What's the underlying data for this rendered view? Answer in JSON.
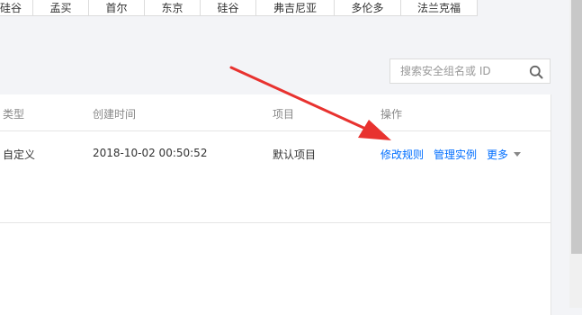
{
  "region_tabs": [
    {
      "label": "硅谷"
    },
    {
      "label": "孟买"
    },
    {
      "label": "首尔"
    },
    {
      "label": "东京"
    },
    {
      "label": "硅谷"
    },
    {
      "label": "弗吉尼亚"
    },
    {
      "label": "多伦多"
    },
    {
      "label": "法兰克福"
    }
  ],
  "search": {
    "placeholder": "搜索安全组名或 ID"
  },
  "table": {
    "headers": {
      "type": "类型",
      "created": "创建时间",
      "project": "项目",
      "actions": "操作"
    },
    "rows": [
      {
        "type": "自定义",
        "created": "2018-10-02 00:50:52",
        "project": "默认项目",
        "actions": {
          "modify": "修改规则",
          "manage": "管理实例",
          "more": "更多"
        }
      }
    ]
  },
  "colors": {
    "link": "#006eff",
    "annotation_arrow": "#e8322f"
  },
  "icons": {
    "search": "search-icon",
    "more": "caret-down-icon",
    "annotation": "arrow-annotation"
  }
}
